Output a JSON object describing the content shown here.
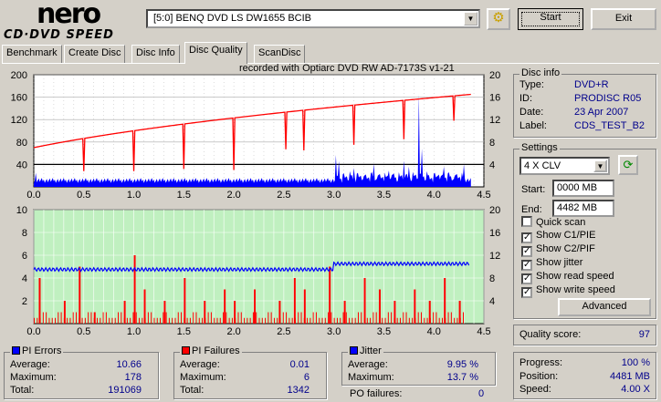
{
  "header": {
    "logo_top": "nero",
    "logo_bottom": "CD·DVD SPEED",
    "drive": "[5:0]  BENQ DVD LS DW1655 BCIB",
    "start": "Start",
    "exit": "Exit"
  },
  "tabs": [
    "Benchmark",
    "Create Disc",
    "Disc Info",
    "Disc Quality",
    "ScanDisc"
  ],
  "active_tab": "Disc Quality",
  "recorded_with": "recorded with Optiarc DVD RW AD-7173S  v1-21",
  "disc_info": {
    "title": "Disc info",
    "type_label": "Type:",
    "type": "DVD+R",
    "id_label": "ID:",
    "id": "PRODISC R05",
    "date_label": "Date:",
    "date": "23 Apr 2007",
    "label_label": "Label:",
    "label": "CDS_TEST_B2"
  },
  "settings": {
    "title": "Settings",
    "speed": "4 X CLV",
    "start_label": "Start:",
    "start": "0000 MB",
    "end_label": "End:",
    "end": "4482 MB",
    "checks": [
      {
        "label": "Quick scan",
        "checked": false
      },
      {
        "label": "Show C1/PIE",
        "checked": true
      },
      {
        "label": "Show C2/PIF",
        "checked": true
      },
      {
        "label": "Show jitter",
        "checked": true
      },
      {
        "label": "Show read speed",
        "checked": true
      },
      {
        "label": "Show write speed",
        "checked": true
      }
    ],
    "advanced": "Advanced"
  },
  "quality": {
    "label": "Quality score:",
    "value": "97"
  },
  "progress": {
    "progress_label": "Progress:",
    "progress": "100 %",
    "position_label": "Position:",
    "position": "4481 MB",
    "speed_label": "Speed:",
    "speed": "4.00 X"
  },
  "pi_errors": {
    "title": "PI Errors",
    "color": "#0000ff",
    "avg_label": "Average:",
    "avg": "10.66",
    "max_label": "Maximum:",
    "max": "178",
    "total_label": "Total:",
    "total": "191069"
  },
  "pi_failures": {
    "title": "PI Failures",
    "color": "#ff0000",
    "avg_label": "Average:",
    "avg": "0.01",
    "max_label": "Maximum:",
    "max": "6",
    "total_label": "Total:",
    "total": "1342"
  },
  "jitter": {
    "title": "Jitter",
    "color": "#0000ff",
    "avg_label": "Average:",
    "avg": "9.95 %",
    "max_label": "Maximum:",
    "max": "13.7 %",
    "po_label": "PO failures:",
    "po": "0"
  },
  "chart_data": [
    {
      "type": "bar",
      "name": "PI errors / read speed",
      "xlim": [
        0,
        4.5
      ],
      "ylim": [
        0,
        200
      ],
      "y2lim": [
        0,
        20
      ],
      "xticks": [
        "0.0",
        "0.5",
        "1.0",
        "1.5",
        "2.0",
        "2.5",
        "3.0",
        "3.5",
        "4.0",
        "4.5"
      ],
      "yticks": [
        "200",
        "160",
        "120",
        "80",
        "40"
      ],
      "y2ticks": [
        "20",
        "16",
        "12",
        "8",
        "4"
      ],
      "pie_baseline": 12,
      "pie_end": 4.37,
      "pie_spikes": [
        [
          0.02,
          25
        ],
        [
          3.02,
          45
        ],
        [
          3.05,
          40
        ],
        [
          3.2,
          30
        ],
        [
          3.4,
          35
        ],
        [
          3.55,
          25
        ],
        [
          3.7,
          45
        ],
        [
          3.75,
          30
        ],
        [
          3.85,
          165
        ],
        [
          3.88,
          60
        ],
        [
          4.05,
          20
        ],
        [
          4.1,
          30
        ],
        [
          4.3,
          40
        ]
      ],
      "read_speed_start": 7,
      "read_speed_end": 16.5,
      "speed_dips": [
        [
          0.5,
          2.8
        ],
        [
          1.0,
          2.8
        ],
        [
          1.5,
          3.2
        ],
        [
          2.0,
          3.0
        ],
        [
          2.52,
          6.7
        ],
        [
          2.7,
          6.5
        ],
        [
          3.2,
          7.5
        ],
        [
          3.7,
          8.5
        ],
        [
          4.2,
          11.8
        ]
      ],
      "write_speed": 4
    },
    {
      "type": "bar",
      "name": "PI failures / jitter",
      "xlim": [
        0,
        4.5
      ],
      "ylim": [
        0,
        10
      ],
      "y2lim": [
        0,
        20
      ],
      "xticks": [
        "0.0",
        "0.5",
        "1.0",
        "1.5",
        "2.0",
        "2.5",
        "3.0",
        "3.5",
        "4.0",
        "4.5"
      ],
      "yticks": [
        "10",
        "8",
        "6",
        "4",
        "2"
      ],
      "y2ticks": [
        "20",
        "16",
        "12",
        "8",
        "4"
      ],
      "jitter_before_3": 9.5,
      "jitter_after_3": 10.5,
      "pif_spikes": [
        [
          0.05,
          4
        ],
        [
          0.3,
          2
        ],
        [
          0.45,
          5
        ],
        [
          0.6,
          1
        ],
        [
          0.9,
          2
        ],
        [
          1.0,
          6
        ],
        [
          1.1,
          3
        ],
        [
          1.3,
          2
        ],
        [
          1.5,
          4
        ],
        [
          1.7,
          2
        ],
        [
          1.9,
          3
        ],
        [
          2.0,
          2
        ],
        [
          2.2,
          3
        ],
        [
          2.45,
          2
        ],
        [
          2.6,
          4
        ],
        [
          2.7,
          3
        ],
        [
          2.95,
          5
        ],
        [
          3.1,
          2
        ],
        [
          3.3,
          4
        ],
        [
          3.45,
          3
        ],
        [
          3.6,
          2
        ],
        [
          3.8,
          3
        ],
        [
          3.95,
          2
        ],
        [
          4.1,
          4
        ],
        [
          4.25,
          2
        ]
      ]
    }
  ]
}
